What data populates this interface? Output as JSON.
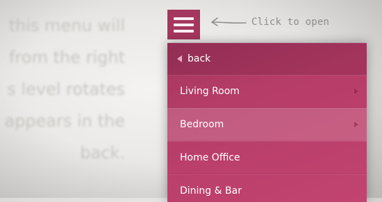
{
  "background_text": {
    "lines": [
      "this menu will",
      "from the right",
      "s level rotates",
      "appears in the",
      "back."
    ]
  },
  "menu_toggle": {
    "icon": "hamburger-icon"
  },
  "hint": {
    "text": "Click to open",
    "icon": "arrow-left-icon"
  },
  "menu": {
    "back": {
      "label": "back",
      "icon": "back-arrow-icon"
    },
    "items": [
      {
        "label": "Living Room",
        "has_submenu": true
      },
      {
        "label": "Bedroom",
        "has_submenu": true,
        "active": true
      },
      {
        "label": "Home Office",
        "has_submenu": false
      },
      {
        "label": "Dining & Bar",
        "has_submenu": false
      }
    ]
  },
  "colors": {
    "accent": "#a3375d",
    "menu_bg": "#b63d68",
    "text": "#ffffff"
  }
}
